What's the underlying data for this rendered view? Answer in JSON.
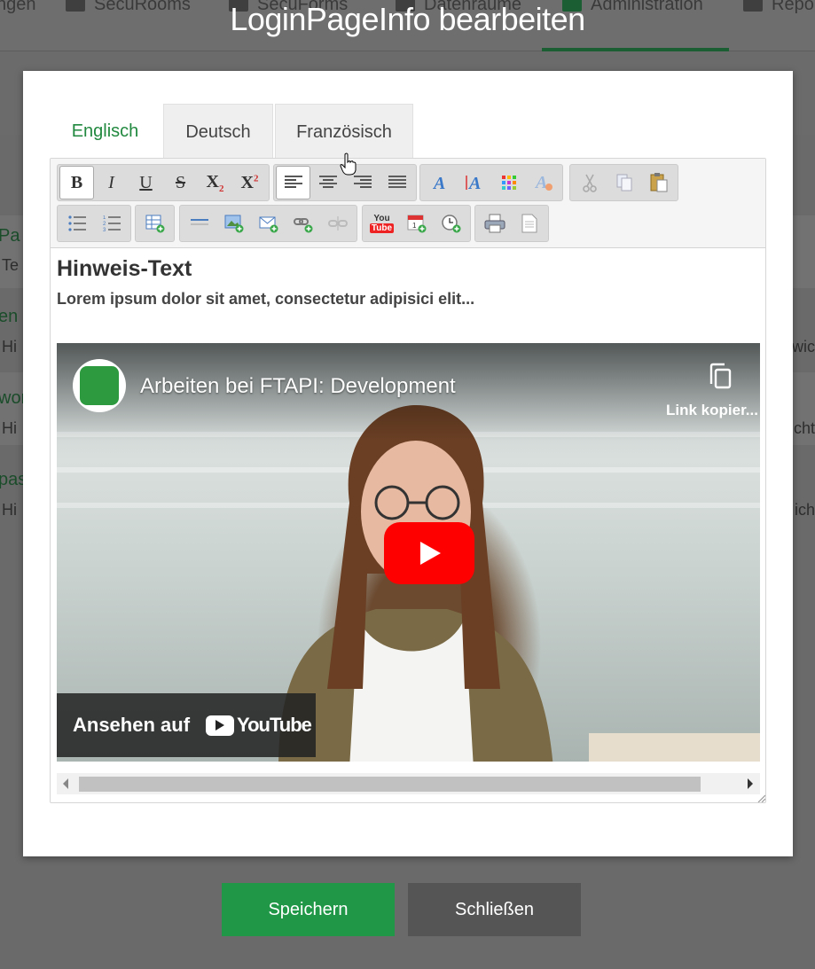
{
  "background_nav": {
    "items": [
      {
        "label": "ngen"
      },
      {
        "label": "SecuRooms"
      },
      {
        "label": "SecuForms"
      },
      {
        "label": "Datenräume"
      },
      {
        "label": "Administration"
      },
      {
        "label": "Repo"
      }
    ]
  },
  "background_rows": [
    {
      "title": "Pa",
      "subtitle": "Te",
      "right": ""
    },
    {
      "title": "en",
      "subtitle": "Hi",
      "right": "wic"
    },
    {
      "title": "wor",
      "subtitle": "Hi",
      "right": "cht"
    },
    {
      "title": "pas",
      "subtitle": "Hi",
      "right": "ich"
    }
  ],
  "dialog": {
    "title": "LoginPageInfo bearbeiten",
    "tabs": [
      {
        "label": "Englisch",
        "active": true
      },
      {
        "label": "Deutsch",
        "active": false
      },
      {
        "label": "Französisch",
        "active": false
      }
    ]
  },
  "toolbar": {
    "row1": [
      {
        "group": "format",
        "buttons": [
          "bold-icon",
          "italic-icon",
          "underline-icon",
          "strikethrough-icon",
          "subscript-icon",
          "superscript-icon"
        ]
      },
      {
        "group": "align",
        "buttons": [
          "align-left-icon",
          "align-center-icon",
          "align-right-icon",
          "align-justify-icon"
        ]
      },
      {
        "group": "style",
        "buttons": [
          "font-icon",
          "font-size-icon",
          "color-palette-icon",
          "clear-format-icon"
        ]
      },
      {
        "group": "clipboard",
        "buttons": [
          "cut-icon",
          "copy-icon",
          "paste-icon"
        ]
      }
    ],
    "row2": [
      {
        "group": "lists",
        "buttons": [
          "bullet-list-icon",
          "numbered-list-icon"
        ]
      },
      {
        "group": "table",
        "buttons": [
          "insert-table-icon"
        ]
      },
      {
        "group": "insert",
        "buttons": [
          "horizontal-rule-icon",
          "insert-image-icon",
          "insert-email-icon",
          "insert-link-icon",
          "unlink-icon"
        ]
      },
      {
        "group": "media",
        "buttons": [
          "youtube-icon",
          "insert-date-icon",
          "insert-time-icon"
        ]
      },
      {
        "group": "print",
        "buttons": [
          "print-icon",
          "document-icon"
        ]
      }
    ],
    "labels": {
      "bold": "B",
      "italic": "I",
      "underline": "U",
      "strike": "S",
      "sub": "X",
      "sub_index": "2",
      "sup": "X",
      "sup_index": "2",
      "youtube_you": "You",
      "youtube_tube": "Tube"
    }
  },
  "content": {
    "heading": "Hinweis-Text",
    "subtext": "Lorem ipsum dolor sit amet, consectetur adipisici elit..."
  },
  "video": {
    "title": "Arbeiten bei FTAPI: Development",
    "copy_label": "Link kopier...",
    "watch_label": "Ansehen auf",
    "youtube_label": "YouTube"
  },
  "buttons": {
    "save": "Speichern",
    "close": "Schließen"
  },
  "colors": {
    "accent_green": "#21893f",
    "save_green": "#1f9747",
    "close_gray": "#555555",
    "youtube_red": "#ff0000"
  }
}
